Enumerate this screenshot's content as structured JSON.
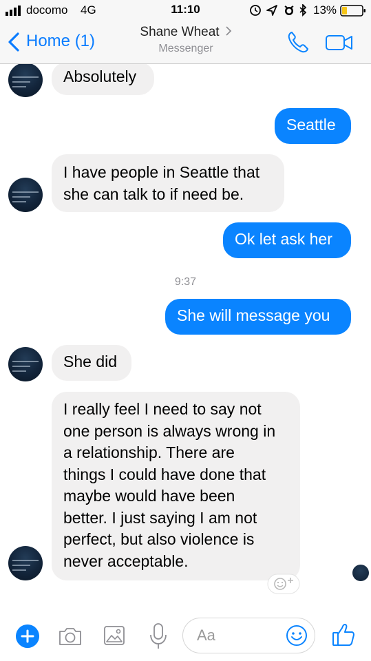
{
  "status_bar": {
    "carrier": "docomo",
    "network": "4G",
    "time": "11:10",
    "battery_percent": "13%"
  },
  "header": {
    "back_label": "Home (1)",
    "contact_name": "Shane Wheat",
    "subtitle": "Messenger",
    "accent_color": "#0a84ff"
  },
  "messages": [
    {
      "from": "contact",
      "text": "Absolutely"
    },
    {
      "from": "me",
      "text": "Seattle"
    },
    {
      "from": "contact",
      "lines": [
        "I have people in Seattle that",
        "she can talk to if need be."
      ]
    },
    {
      "from": "me",
      "text": "Ok let ask her"
    },
    {
      "timestamp": "9:37"
    },
    {
      "from": "me",
      "text": "She will message you"
    },
    {
      "from": "contact",
      "text": "She did"
    },
    {
      "from": "contact",
      "lines": [
        "I really feel I need to say not",
        "one person is always wrong in",
        "a relationship. There are",
        "things I could have done that",
        "maybe would have been",
        "better. I  just saying I am not",
        "perfect, but also violence is",
        "never acceptable."
      ]
    }
  ],
  "composer": {
    "placeholder": "Aa"
  },
  "icons": [
    "signal-icon",
    "alarm-icon",
    "location-icon",
    "bluetooth-icon",
    "battery-icon",
    "chevron-left-icon",
    "chevron-right-icon",
    "phone-icon",
    "video-icon",
    "add-reaction-icon",
    "plus-icon",
    "camera-icon",
    "image-icon",
    "microphone-icon",
    "emoji-icon",
    "thumbs-up-icon"
  ]
}
